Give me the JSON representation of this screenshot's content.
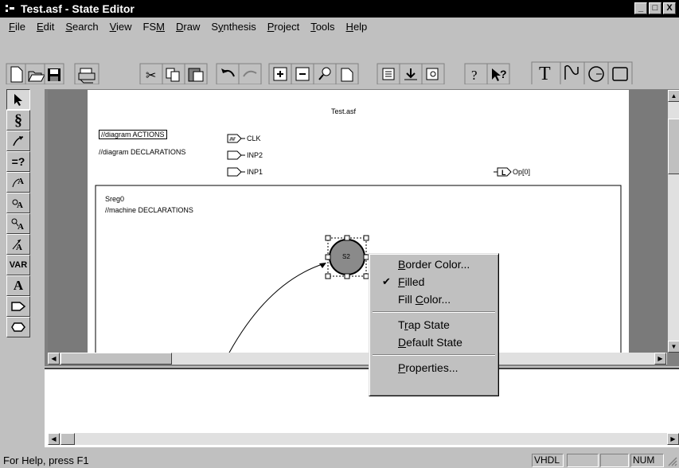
{
  "window": {
    "title": "Test.asf - State Editor",
    "controls": [
      "_",
      "□",
      "X"
    ]
  },
  "menubar": {
    "items": [
      {
        "key": "F",
        "rest": "ile"
      },
      {
        "key": "E",
        "rest": "dit"
      },
      {
        "key": "S",
        "rest": "earch"
      },
      {
        "key": "V",
        "rest": "iew"
      },
      {
        "pre": "FS",
        "key": "M",
        "rest": ""
      },
      {
        "key": "D",
        "rest": "raw"
      },
      {
        "pre": "S",
        "key": "y",
        "rest": "nthesis"
      },
      {
        "key": "P",
        "rest": "roject"
      },
      {
        "key": "T",
        "rest": "ools"
      },
      {
        "key": "H",
        "rest": "elp"
      }
    ]
  },
  "toolbar": {
    "icons": [
      "new-icon",
      "open-icon",
      "save-icon",
      "print-icon",
      "cut-icon",
      "copy-icon",
      "paste-icon",
      "undo-icon",
      "redo-icon",
      "zoom-in-icon",
      "zoom-out-icon",
      "zoom-icon",
      "page-icon",
      "compile-icon",
      "download-icon",
      "inspect-icon",
      "help-icon",
      "context-help-icon",
      "text-tool-icon",
      "curve-tool-icon",
      "circle-tool-icon",
      "rectangle-tool-icon"
    ],
    "text_tool": "T"
  },
  "lefttools": {
    "labels": [
      "",
      "",
      "",
      "=?",
      "",
      "",
      "",
      "",
      "VAR",
      "A",
      "",
      ""
    ]
  },
  "diagram": {
    "title": "Test.asf",
    "actions": "//diagram ACTIONS",
    "declarations": "//diagram DECLARATIONS",
    "inputs": [
      "CLK",
      "INP2",
      "INP1"
    ],
    "output": "Op[0]",
    "machine_name": "Sreg0",
    "machine_decl": "//machine DECLARATIONS",
    "state_label": "S2"
  },
  "context_menu": {
    "items": [
      {
        "pre": "",
        "key": "B",
        "rest": "order Color...",
        "checked": false
      },
      {
        "pre": "",
        "key": "F",
        "rest": "illed",
        "checked": true
      },
      {
        "pre": "Fill ",
        "key": "C",
        "rest": "olor...",
        "checked": false
      },
      {
        "sep": true
      },
      {
        "pre": "T",
        "key": "r",
        "rest": "ap State",
        "checked": false
      },
      {
        "pre": "",
        "key": "D",
        "rest": "efault State",
        "checked": false
      },
      {
        "sep": true
      },
      {
        "pre": "",
        "key": "P",
        "rest": "roperties...",
        "checked": false
      }
    ]
  },
  "status": {
    "help_text": "For Help, press F1",
    "lang": "VHDL",
    "num": "NUM"
  }
}
